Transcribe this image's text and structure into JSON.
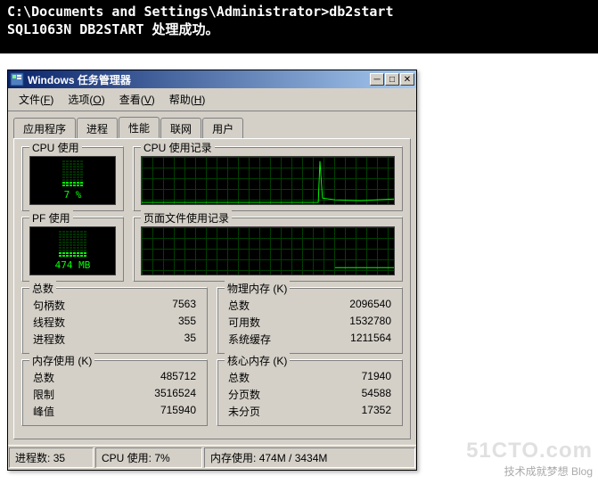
{
  "terminal": {
    "line1": "C:\\Documents and Settings\\Administrator>db2start",
    "line2": "SQL1063N  DB2START 处理成功。"
  },
  "window": {
    "title": "Windows 任务管理器",
    "menus": {
      "file": "文件(F)",
      "options": "选项(O)",
      "view": "查看(V)",
      "help": "帮助(H)"
    },
    "tabs": {
      "apps": "应用程序",
      "processes": "进程",
      "performance": "性能",
      "networking": "联网",
      "users": "用户"
    }
  },
  "perf": {
    "cpu_usage_title": "CPU 使用",
    "cpu_usage_value": "7 %",
    "cpu_history_title": "CPU 使用记录",
    "pf_usage_title": "PF 使用",
    "pf_usage_value": "474 MB",
    "pf_history_title": "页面文件使用记录"
  },
  "totals": {
    "title": "总数",
    "handles_label": "句柄数",
    "handles": "7563",
    "threads_label": "线程数",
    "threads": "355",
    "processes_label": "进程数",
    "processes": "35"
  },
  "physmem": {
    "title": "物理内存 (K)",
    "total_label": "总数",
    "total": "2096540",
    "avail_label": "可用数",
    "avail": "1532780",
    "cache_label": "系统缓存",
    "cache": "1211564"
  },
  "commit": {
    "title": "内存使用 (K)",
    "total_label": "总数",
    "total": "485712",
    "limit_label": "限制",
    "limit": "3516524",
    "peak_label": "峰值",
    "peak": "715940"
  },
  "kernel": {
    "title": "核心内存 (K)",
    "total_label": "总数",
    "total": "71940",
    "paged_label": "分页数",
    "paged": "54588",
    "nonpaged_label": "未分页",
    "nonpaged": "17352"
  },
  "statusbar": {
    "processes_label": "进程数:",
    "processes": "35",
    "cpu_label": "CPU 使用:",
    "cpu": "7%",
    "mem_label": "内存使用:",
    "mem": "474M / 3434M"
  },
  "watermark": {
    "brand": "51CTO.com",
    "tagline": "技术成就梦想  Blog"
  },
  "chart_data": [
    {
      "type": "line",
      "title": "CPU 使用记录",
      "ylim": [
        0,
        100
      ],
      "ylabel": "CPU %",
      "current": 7,
      "series": [
        {
          "name": "cpu",
          "values": [
            2,
            2,
            2,
            2,
            2,
            2,
            2,
            2,
            2,
            2,
            2,
            2,
            2,
            2,
            2,
            2,
            2,
            2,
            2,
            2,
            2,
            2,
            2,
            2,
            2,
            2,
            2,
            2,
            2,
            2,
            2,
            2,
            2,
            2,
            2,
            2,
            2,
            2,
            2,
            2,
            95,
            8,
            5,
            5,
            3,
            3,
            3,
            3,
            3,
            3,
            3,
            3,
            3,
            3,
            3,
            7
          ]
        }
      ]
    },
    {
      "type": "line",
      "title": "页面文件使用记录",
      "ylim": [
        0,
        3434
      ],
      "ylabel": "MB",
      "current": 474,
      "series": [
        {
          "name": "pf",
          "values": [
            470,
            470,
            470,
            470,
            470,
            470,
            470,
            470,
            470,
            470,
            470,
            470,
            470,
            470
          ]
        }
      ]
    },
    {
      "type": "bar",
      "title": "CPU 使用",
      "ylim": [
        0,
        100
      ],
      "categories": [
        "cpu"
      ],
      "values": [
        7
      ]
    },
    {
      "type": "bar",
      "title": "PF 使用",
      "ylim": [
        0,
        3434
      ],
      "categories": [
        "pf_mb"
      ],
      "values": [
        474
      ]
    }
  ]
}
